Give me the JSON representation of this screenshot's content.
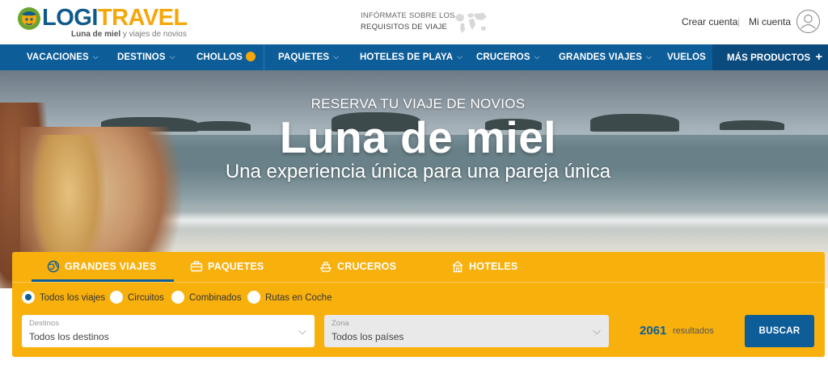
{
  "header": {
    "logo_part1": "LOGI",
    "logo_part2": "TRAVEL",
    "tagline_bold": "Luna de miel",
    "tagline_rest": " y viajes de novios",
    "info_line1": "INFÓRMATE SOBRE LOS",
    "info_line2": "REQUISITOS DE VIAJE",
    "create_account": "Crear cuenta",
    "separator": "|",
    "my_account": "Mi cuenta"
  },
  "nav": {
    "items": [
      {
        "label": "VACACIONES",
        "has_chevron": true
      },
      {
        "label": "DESTINOS",
        "has_chevron": true
      },
      {
        "label": "CHOLLOS",
        "has_chevron": false
      },
      {
        "label": "PAQUETES",
        "has_chevron": true
      },
      {
        "label": "HOTELES DE PLAYA",
        "has_chevron": true
      },
      {
        "label": "CRUCEROS",
        "has_chevron": true
      },
      {
        "label": "GRANDES VIAJES",
        "has_chevron": true
      },
      {
        "label": "VUELOS",
        "has_chevron": false
      }
    ],
    "more": "MÁS PRODUCTOS",
    "more_symbol": "+",
    "chevron": "⌵"
  },
  "hero": {
    "subtitle": "RESERVA TU VIAJE DE NOVIOS",
    "title": "Luna de miel",
    "tagline": "Una experiencia única para una pareja única"
  },
  "search": {
    "tabs": [
      {
        "label": "GRANDES VIAJES",
        "icon": "globe-icon",
        "active": true
      },
      {
        "label": "PAQUETES",
        "icon": "suitcase-icon",
        "active": false
      },
      {
        "label": "CRUCEROS",
        "icon": "ship-icon",
        "active": false
      },
      {
        "label": "HOTELES",
        "icon": "hotel-icon",
        "active": false
      }
    ],
    "options": [
      {
        "label": "Todos los viajes",
        "selected": true
      },
      {
        "label": "Circuitos",
        "selected": false
      },
      {
        "label": "Combinados",
        "selected": false
      },
      {
        "label": "Rutas en Coche",
        "selected": false
      }
    ],
    "destinos": {
      "label": "Destinos",
      "value": "Todos los destinos"
    },
    "zona": {
      "label": "Zona",
      "value": "Todos los países"
    },
    "results_count": "2061",
    "results_label": "resultados",
    "button": "BUSCAR"
  },
  "colors": {
    "brand_blue": "#0d5d99",
    "brand_orange": "#f8b00d",
    "nav_more_bg": "#0a4a7d"
  }
}
